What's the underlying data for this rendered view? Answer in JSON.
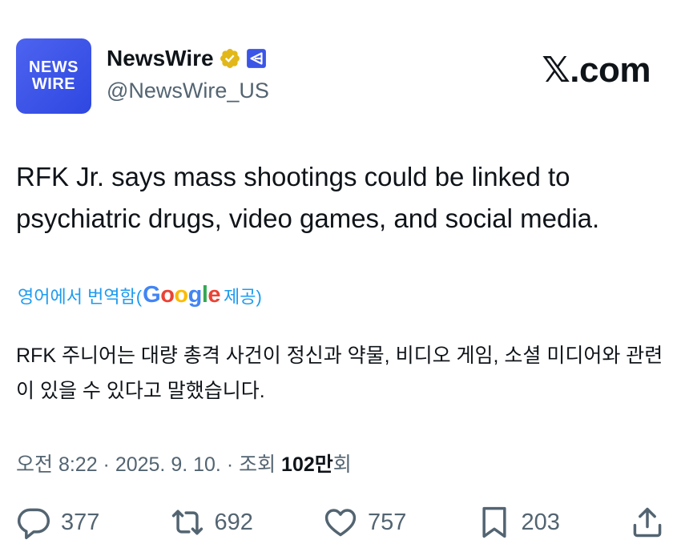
{
  "account": {
    "avatar_line1": "NEWS",
    "avatar_line2": "WIRE",
    "display_name": "NewsWire",
    "handle": "@NewsWire_US",
    "verified_icon": "gold-verified-badge-icon",
    "affiliate_icon": "affiliate-badge-icon",
    "brand_color": "#3b55e6"
  },
  "brand_mark": "𝕏.com",
  "tweet": {
    "text": "RFK Jr. says mass shootings could be linked to psychiatric drugs, video games, and social media."
  },
  "translation": {
    "prefix": "영어에서 번역함(",
    "google_letters": [
      {
        "ch": "G",
        "color": "#4285F4"
      },
      {
        "ch": "o",
        "color": "#EA4335"
      },
      {
        "ch": "o",
        "color": "#FBBC05"
      },
      {
        "ch": "g",
        "color": "#4285F4"
      },
      {
        "ch": "l",
        "color": "#34A853"
      },
      {
        "ch": "e",
        "color": "#EA4335"
      }
    ],
    "suffix": "제공)",
    "text": "RFK 주니어는 대량 총격 사건이 정신과 약물, 비디오 게임, 소셜 미디어와 관련이 있을 수 있다고 말했습니다."
  },
  "meta": {
    "time_date": "오전 8:22 · 2025. 9. 10. · 조회 ",
    "views": "102만",
    "views_suffix": "회"
  },
  "actions": {
    "replies": "377",
    "reposts": "692",
    "likes": "757",
    "bookmarks": "203"
  },
  "colors": {
    "text_primary": "#0f1419",
    "text_secondary": "#536471",
    "link_blue": "#1d9bf0",
    "verified_gold": "#e2b719"
  }
}
